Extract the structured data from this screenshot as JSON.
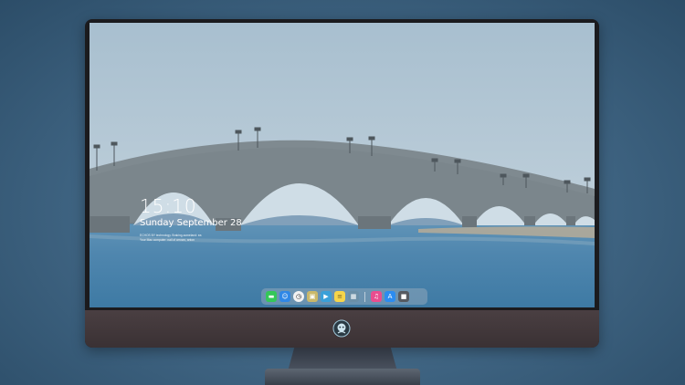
{
  "lock_screen": {
    "time": "15:10",
    "date": "Sunday September 28",
    "note_line_1": "ECHOS BY technology. Braking-someland: ea",
    "note_line_2": "Your Mac computer: nail of arrows; anton"
  },
  "dock": {
    "apps": [
      {
        "name": "Messages",
        "color": "#34c759",
        "glyph": "▬"
      },
      {
        "name": "Finder",
        "color": "#2f87e6",
        "glyph": "☺"
      },
      {
        "name": "Clock",
        "color": "#f2f2f2",
        "glyph": "◷"
      },
      {
        "name": "Preview",
        "color": "#c9b86a",
        "glyph": "▣"
      },
      {
        "name": "Final Cut Pro",
        "color": "#3aa0d8",
        "glyph": "▶"
      },
      {
        "name": "Notes",
        "color": "#f6d54a",
        "glyph": "≡"
      },
      {
        "name": "Photo Booth",
        "color": "#6b8fa7",
        "glyph": "▦"
      },
      {
        "name": "iTunes",
        "color": "#e94d8f",
        "glyph": "♫"
      },
      {
        "name": "App Store",
        "color": "#2b8cf0",
        "glyph": "A"
      },
      {
        "name": "Screenshot",
        "color": "#555a61",
        "glyph": "■"
      }
    ]
  },
  "colors": {
    "sky": "#a9bfce",
    "water": "#5d8fb3",
    "bridge": "#7f8a90",
    "monitor_chin": "#433a3d"
  }
}
